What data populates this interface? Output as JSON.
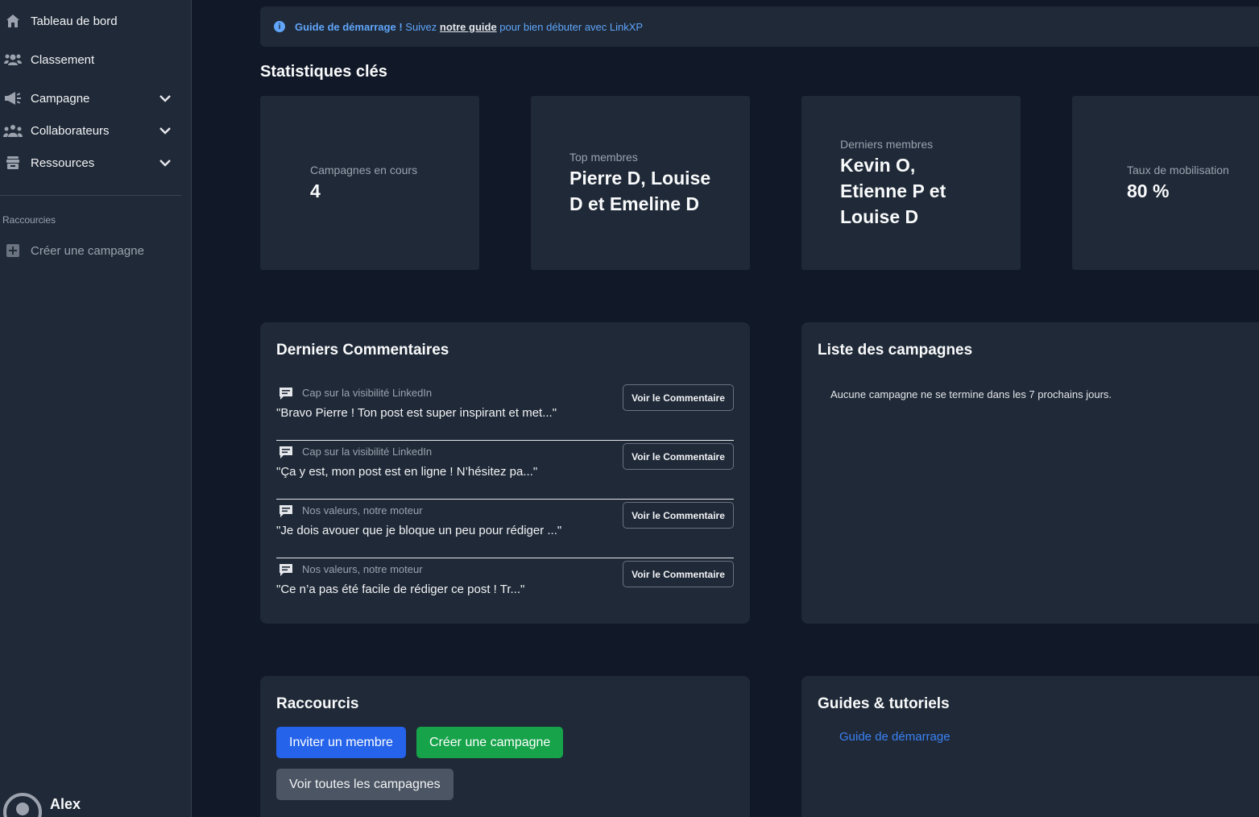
{
  "sidebar": {
    "items": [
      {
        "label": "Tableau de bord",
        "icon": "home-icon"
      },
      {
        "label": "Classement",
        "icon": "users-ranking-icon"
      },
      {
        "label": "Campagne",
        "icon": "megaphone-icon"
      },
      {
        "label": "Collaborateurs",
        "icon": "group-icon"
      },
      {
        "label": "Ressources",
        "icon": "archive-icon"
      }
    ],
    "shortcuts_heading": "Raccourcies",
    "create_campaign": "Créer une campagne",
    "user_name": "Alex"
  },
  "banner": {
    "strong": "Guide de démarrage !",
    "text_before": " Suivez ",
    "link": "notre guide",
    "text_after": " pour bien débuter avec LinkXP"
  },
  "stats": {
    "title": "Statistiques clés",
    "cards": [
      {
        "label": "Campagnes en cours",
        "value": "4"
      },
      {
        "label": "Top membres",
        "value_lines": [
          "Pierre D, Louise",
          "D et Emeline D"
        ]
      },
      {
        "label": "Derniers membres",
        "value_lines": [
          "Kevin O,",
          "Etienne P et",
          "Louise D"
        ]
      },
      {
        "label": "Taux de mobilisation",
        "value": "80 %"
      }
    ]
  },
  "comments": {
    "title": "Derniers Commentaires",
    "button_label": "Voir le Commentaire",
    "items": [
      {
        "campaign": "Cap sur la visibilité LinkedIn",
        "text": "\"Bravo Pierre ! Ton post est super inspirant et met...\""
      },
      {
        "campaign": "Cap sur la visibilité LinkedIn",
        "text": "\"Ça y est, mon post est en ligne ! N’hésitez pa...\""
      },
      {
        "campaign": "Nos valeurs, notre moteur",
        "text": "\"Je dois avouer que je bloque un peu pour rédiger ...\""
      },
      {
        "campaign": "Nos valeurs, notre moteur",
        "text": "\"Ce n’a pas été facile de rédiger ce post ! Tr...\""
      }
    ]
  },
  "campaign_list": {
    "title": "Liste des campagnes",
    "empty": "Aucune campagne ne se termine dans les 7 prochains jours."
  },
  "shortcuts": {
    "title": "Raccourcis",
    "invite": "Inviter un membre",
    "create": "Créer une campagne",
    "view_all": "Voir toutes les campagnes"
  },
  "guides": {
    "title": "Guides & tutoriels",
    "link": "Guide de démarrage"
  },
  "colors": {
    "background": "#111827",
    "surface": "#1f2937",
    "primary": "#2563eb",
    "success": "#16a34a",
    "neutral": "#4b5563",
    "link": "#3b82f6"
  }
}
